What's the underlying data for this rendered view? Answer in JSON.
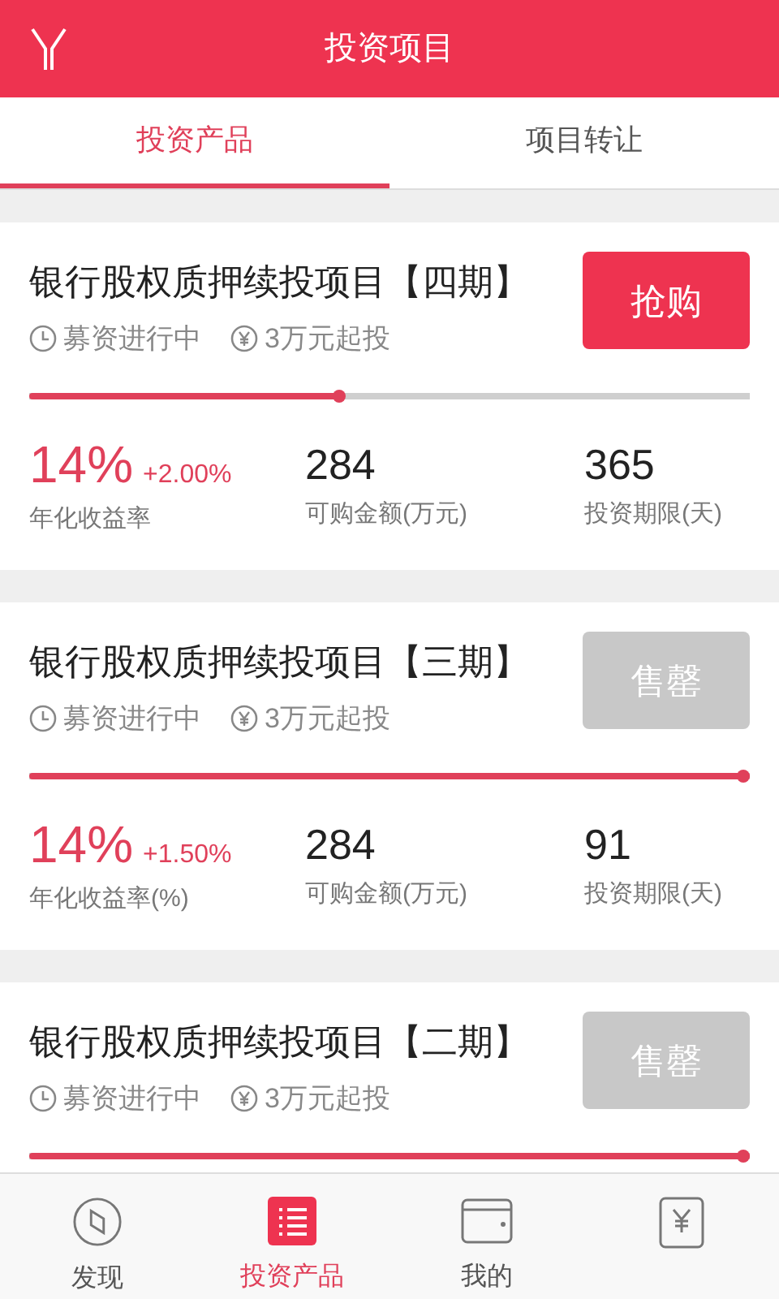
{
  "header": {
    "title": "投资项目"
  },
  "tabs": [
    {
      "label": "投资产品",
      "selected": true
    },
    {
      "label": "项目转让",
      "selected": false
    }
  ],
  "products": [
    {
      "title": "银行股权质押续投项目【四期】",
      "status": "募资进行中",
      "min_invest": "3万元起投",
      "button": "抢购",
      "disabled": false,
      "level": 0.43,
      "stats": {
        "rate": "14%",
        "bonus": "+2.00%",
        "rate_label": "年化收益率",
        "amount": "284",
        "amount_label": "可购金额(万元)",
        "term": "365",
        "term_label": "投资期限(天)"
      }
    },
    {
      "title": "银行股权质押续投项目【三期】",
      "status": "募资进行中",
      "min_invest": "3万元起投",
      "button": "售罄",
      "disabled": true,
      "level": 1,
      "stats": {
        "rate": "14%",
        "bonus": "+1.50%",
        "rate_label": "年化收益率(%)",
        "amount": "284",
        "amount_label": "可购金额(万元)",
        "term": "91",
        "term_label": "投资期限(天)"
      }
    },
    {
      "title": "银行股权质押续投项目【二期】",
      "status": "募资进行中",
      "min_invest": "3万元起投",
      "button": "售罄",
      "disabled": true,
      "level": 1
    }
  ],
  "bottom_nav": [
    {
      "kind": "compass",
      "label": "发现",
      "selected": false
    },
    {
      "kind": "list",
      "label": "投资产品",
      "selected": true
    },
    {
      "kind": "wallet",
      "label": "我的",
      "selected": false
    },
    {
      "kind": "yen",
      "selected": false
    }
  ]
}
